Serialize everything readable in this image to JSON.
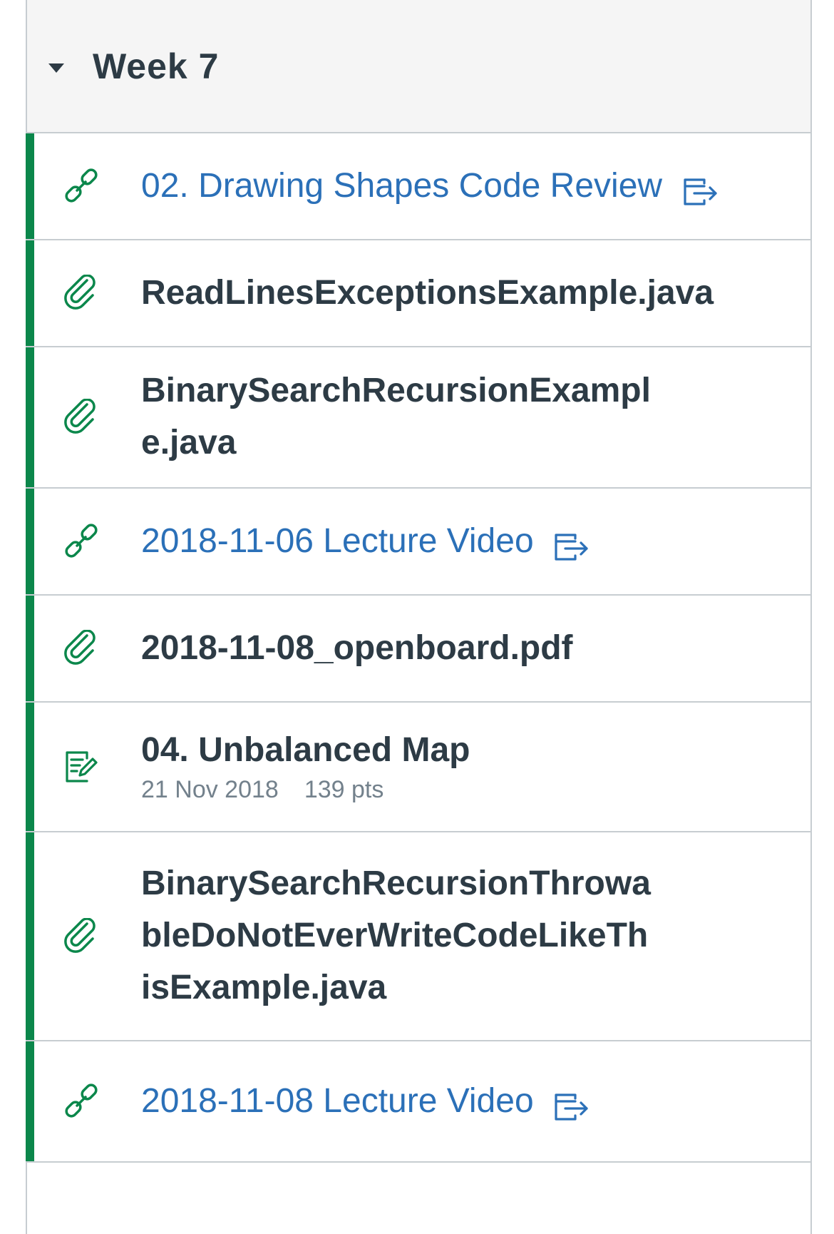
{
  "module": {
    "title": "Week 7"
  },
  "items": [
    {
      "title": "02. Drawing Shapes Code Review"
    },
    {
      "title": "ReadLinesExceptionsExample.java"
    },
    {
      "title": "BinarySearchRecursionExample.java"
    },
    {
      "title": "2018-11-06 Lecture Video"
    },
    {
      "title": "2018-11-08_openboard.pdf"
    },
    {
      "title": "04. Unbalanced Map",
      "date": "21 Nov 2018",
      "points": "139 pts"
    },
    {
      "title": "BinarySearchRecursionThrowableDoNotEverWriteCodeLikeThisExample.java"
    },
    {
      "title": "2018-11-08 Lecture Video"
    }
  ],
  "colors": {
    "published": "#0b874b",
    "link": "#2b70b8",
    "text": "#2d3b45",
    "muted": "#73818c"
  },
  "icons": {
    "external_link": "link-icon",
    "attachment": "paperclip-icon",
    "assignment": "assignment-icon",
    "new_window": "external-window-icon"
  }
}
